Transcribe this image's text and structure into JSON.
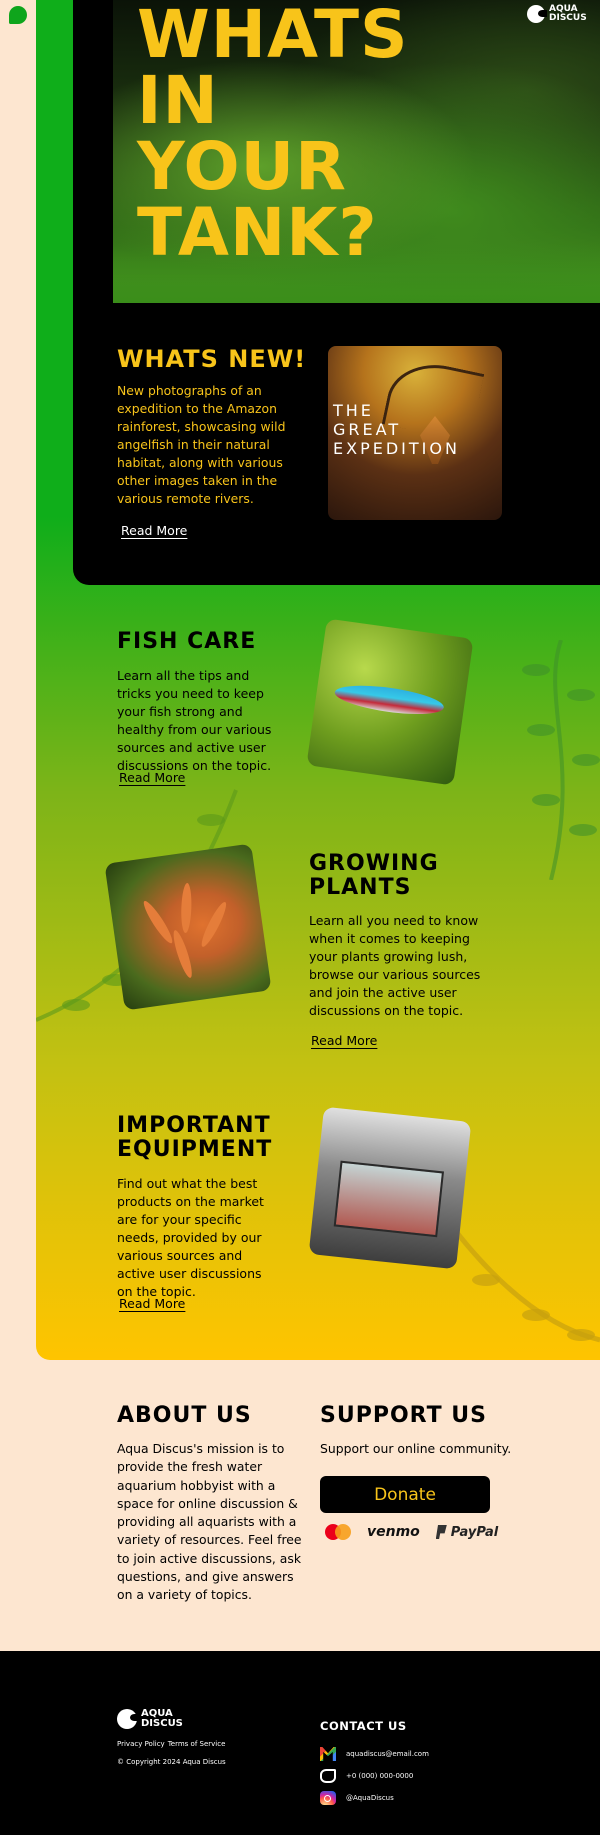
{
  "brand": {
    "name": "AQUA\nDISCUS"
  },
  "hero": {
    "title": "WHATS\nIN\nYOUR\nTANK?"
  },
  "whats_new": {
    "heading": "WHATS NEW!",
    "text": "New photographs of an expedition to the Amazon rainforest, showcasing wild angelfish in their natural habitat, along with various other images taken in the various remote rivers.",
    "read_more": "Read More",
    "card_label": "THE\nGREAT\nEXPEDITION"
  },
  "sections": [
    {
      "heading": "FISH CARE",
      "text": "Learn all the tips and tricks you need to keep your fish strong and healthy from our various sources and active user discussions on the topic.",
      "read_more": "Read More"
    },
    {
      "heading": "GROWING\nPLANTS",
      "text": "Learn all you need to know when it comes to keeping your plants growing lush, browse our various sources and join the active user discussions on the topic.",
      "read_more": "Read More"
    },
    {
      "heading": "IMPORTANT\nEQUIPMENT",
      "text": "Find out what the best products on the market are for your specific needs, provided by our various sources and active user discussions on the topic.",
      "read_more": "Read More"
    }
  ],
  "about": {
    "heading": "ABOUT US",
    "text": "Aqua Discus's mission is to provide the fresh water aquarium hobbyist with a space for online discussion & providing all aquarists with a variety of resources. Feel free to join active discussions, ask questions, and give answers on a variety of topics."
  },
  "support": {
    "heading": "SUPPORT US",
    "text": "Support our online community.",
    "donate_label": "Donate",
    "payments": {
      "venmo": "venmo",
      "paypal": "PayPal"
    }
  },
  "footer": {
    "privacy": "Privacy Policy",
    "terms": "Terms of Service",
    "copyright": "© Copyright 2024 Aqua Discus",
    "contact_heading": "CONTACT US",
    "email": "aquadiscus@email.com",
    "phone": "+0 (000) 000-0000",
    "instagram": "@AquaDiscus"
  },
  "colors": {
    "accent_yellow": "#f8c41a",
    "green": "#0fae1a",
    "cream": "#fde6d0",
    "black": "#000000"
  },
  "icons": [
    "mail-icon",
    "phone-icon",
    "instagram-icon",
    "mastercard-icon",
    "paypal-icon"
  ]
}
